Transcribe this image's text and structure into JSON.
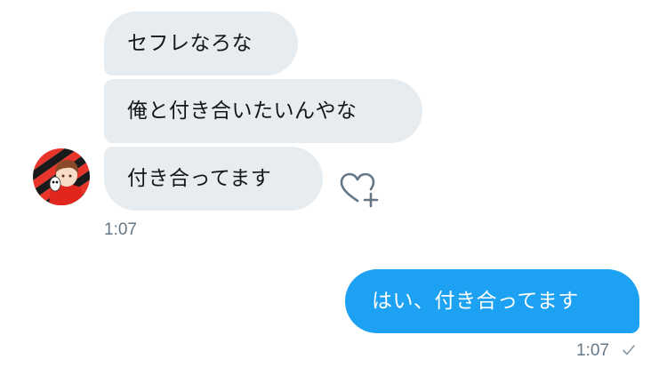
{
  "conversation": {
    "incoming": [
      {
        "text": "セフレなろな"
      },
      {
        "text": "俺と付き合いたいんやな"
      },
      {
        "text": "付き合ってます"
      }
    ],
    "incoming_time": "1:07",
    "outgoing": [
      {
        "text": "はい、付き合ってます"
      }
    ],
    "outgoing_time": "1:07"
  },
  "icons": {
    "avatar": "user-avatar",
    "reaction": "heart-plus-icon",
    "status": "checkmark-icon"
  },
  "colors": {
    "incoming_bubble": "#e6ecf0",
    "outgoing_bubble": "#1da1f2",
    "timestamp": "#657786"
  }
}
